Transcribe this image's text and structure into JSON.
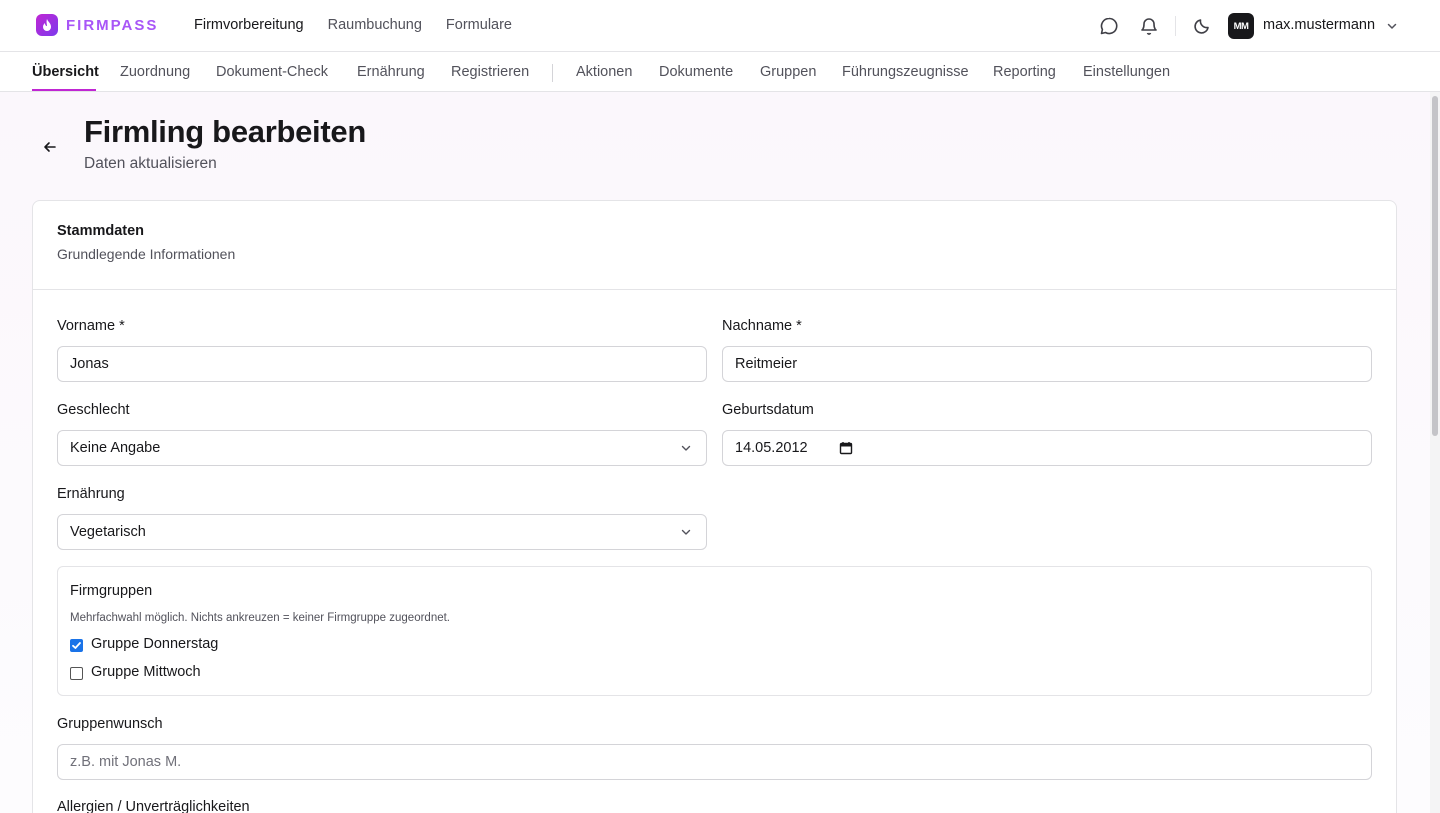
{
  "brand": {
    "name": "FIRMPASS"
  },
  "mainnav": [
    "Firmvorbereitung",
    "Raumbuchung",
    "Formulare"
  ],
  "user": {
    "initials": "MM",
    "name": "max.mustermann"
  },
  "subnav": {
    "items": [
      "Übersicht",
      "Zuordnung",
      "Dokument-Check",
      "Ernährung",
      "Registrieren",
      "Aktionen",
      "Dokumente",
      "Gruppen",
      "Führungszeugnisse",
      "Reporting",
      "Einstellungen"
    ],
    "active": "Übersicht"
  },
  "page": {
    "title": "Firmling bearbeiten",
    "subtitle": "Daten aktualisieren"
  },
  "card": {
    "title": "Stammdaten",
    "description": "Grundlegende Informationen"
  },
  "form": {
    "vorname": {
      "label": "Vorname *",
      "value": "Jonas"
    },
    "nachname": {
      "label": "Nachname *",
      "value": "Reitmeier"
    },
    "geschlecht": {
      "label": "Geschlecht",
      "value": "Keine Angabe"
    },
    "geburtsdatum": {
      "label": "Geburtsdatum",
      "value": "14.05.2012"
    },
    "ernaehrung": {
      "label": "Ernährung",
      "value": "Vegetarisch"
    },
    "firmgruppen": {
      "title": "Firmgruppen",
      "hint": "Mehrfachwahl möglich. Nichts ankreuzen = keiner Firmgruppe zugeordnet.",
      "options": [
        {
          "label": "Gruppe Donnerstag",
          "checked": true
        },
        {
          "label": "Gruppe Mittwoch",
          "checked": false
        }
      ]
    },
    "gruppenwunsch": {
      "label": "Gruppenwunsch",
      "placeholder": "z.B. mit Jonas M."
    },
    "allergien": {
      "label": "Allergien / Unverträglichkeiten"
    }
  },
  "colors": {
    "accent": "#c026d3",
    "brand": "#a855f7",
    "checkbox": "#1a73e8"
  }
}
